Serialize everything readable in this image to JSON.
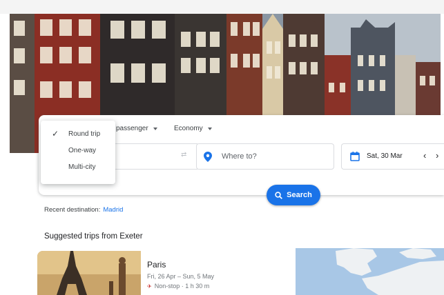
{
  "header": {
    "trip_type": "Round trip",
    "passengers": "passenger",
    "cabin_class": "Economy"
  },
  "trip_menu": {
    "items": [
      {
        "label": "Round trip",
        "selected": true
      },
      {
        "label": "One-way",
        "selected": false
      },
      {
        "label": "Multi-city",
        "selected": false
      }
    ]
  },
  "search": {
    "to_placeholder": "Where to?",
    "date": "Sat, 30 Mar",
    "button_label": "Search"
  },
  "recent": {
    "label": "Recent destination:",
    "destination": "Madrid"
  },
  "suggested": {
    "title": "Suggested trips from Exeter",
    "trips": [
      {
        "city": "Paris",
        "dates": "Fri, 26 Apr – Sun, 5 May",
        "info": "Non-stop · 1 h 30 m"
      }
    ]
  },
  "colors": {
    "accent": "#1a73e8",
    "text": "#202124",
    "muted": "#70757a"
  }
}
